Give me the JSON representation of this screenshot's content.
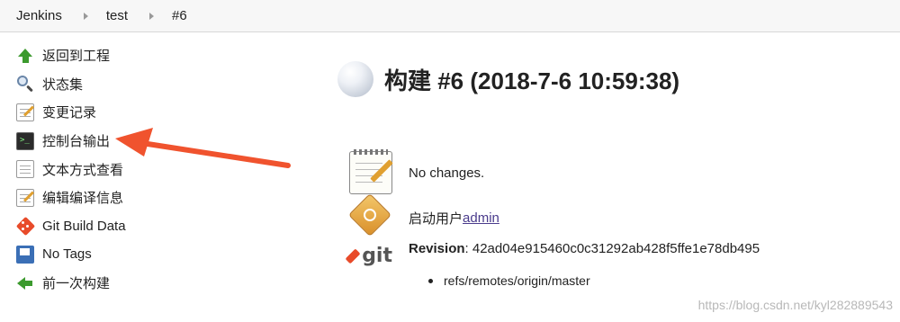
{
  "breadcrumb": {
    "items": [
      "Jenkins",
      "test",
      "#6"
    ]
  },
  "sidebar": {
    "items": [
      {
        "label": "返回到工程",
        "icon": "up-arrow-icon"
      },
      {
        "label": "状态集",
        "icon": "search-icon"
      },
      {
        "label": "变更记录",
        "icon": "notepad-icon"
      },
      {
        "label": "控制台输出",
        "icon": "terminal-icon"
      },
      {
        "label": "文本方式查看",
        "icon": "document-icon"
      },
      {
        "label": "编辑编译信息",
        "icon": "notepad-icon"
      },
      {
        "label": "Git Build Data",
        "icon": "git-icon"
      },
      {
        "label": "No Tags",
        "icon": "tags-icon"
      },
      {
        "label": "前一次构建",
        "icon": "back-arrow-icon"
      }
    ]
  },
  "main": {
    "title": "构建 #6 (2018-7-6 10:59:38)",
    "changes_text": "No changes.",
    "started_by_prefix": "启动用户",
    "started_by_user": "admin",
    "revision_label": "Revision",
    "revision_value": ": 42ad04e915460c0c31292ab428f5ffe1e78db495",
    "git_logo_text": "git",
    "branches": [
      "refs/remotes/origin/master"
    ]
  },
  "watermark": "https://blog.csdn.net/kyl282889543",
  "colors": {
    "accent_red": "#e84b2a",
    "link": "#4a3b8c",
    "annotation_arrow": "#f0532e"
  }
}
